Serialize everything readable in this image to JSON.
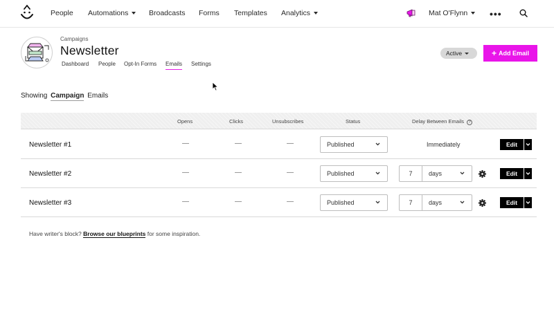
{
  "nav": {
    "items": [
      {
        "label": "People",
        "dropdown": false
      },
      {
        "label": "Automations",
        "dropdown": true
      },
      {
        "label": "Broadcasts",
        "dropdown": false
      },
      {
        "label": "Forms",
        "dropdown": false
      },
      {
        "label": "Templates",
        "dropdown": false
      },
      {
        "label": "Analytics",
        "dropdown": true
      }
    ],
    "user_name": "Mat O'Flynn",
    "more_icon": "ellipsis-icon",
    "search_icon": "search-icon"
  },
  "campaign": {
    "breadcrumb": "Campaigns",
    "title": "Newsletter",
    "tabs": [
      {
        "label": "Dashboard",
        "active": false
      },
      {
        "label": "People",
        "active": false
      },
      {
        "label": "Opt-In Forms",
        "active": false
      },
      {
        "label": "Emails",
        "active": true
      },
      {
        "label": "Settings",
        "active": false
      }
    ],
    "status": "Active",
    "add_email_label": "Add Email"
  },
  "showing": {
    "prefix": "Showing",
    "filter": "Campaign",
    "suffix": "Emails"
  },
  "table": {
    "headers": {
      "opens": "Opens",
      "clicks": "Clicks",
      "unsubscribes": "Unsubscribes",
      "status": "Status",
      "delay": "Delay Between Emails"
    },
    "rows": [
      {
        "name": "Newsletter #1",
        "opens": "—",
        "clicks": "—",
        "unsubscribes": "—",
        "status": "Published",
        "delay_text": "Immediately",
        "edit_label": "Edit"
      },
      {
        "name": "Newsletter #2",
        "opens": "—",
        "clicks": "—",
        "unsubscribes": "—",
        "status": "Published",
        "delay_value": "7",
        "delay_unit": "days",
        "edit_label": "Edit"
      },
      {
        "name": "Newsletter #3",
        "opens": "—",
        "clicks": "—",
        "unsubscribes": "—",
        "status": "Published",
        "delay_value": "7",
        "delay_unit": "days",
        "edit_label": "Edit"
      }
    ]
  },
  "footer": {
    "prefix": "Have writer's block?",
    "link": "Browse our blueprints",
    "suffix": "for some inspiration."
  },
  "colors": {
    "accent": "#e915e9",
    "edit_button": "#000000"
  }
}
